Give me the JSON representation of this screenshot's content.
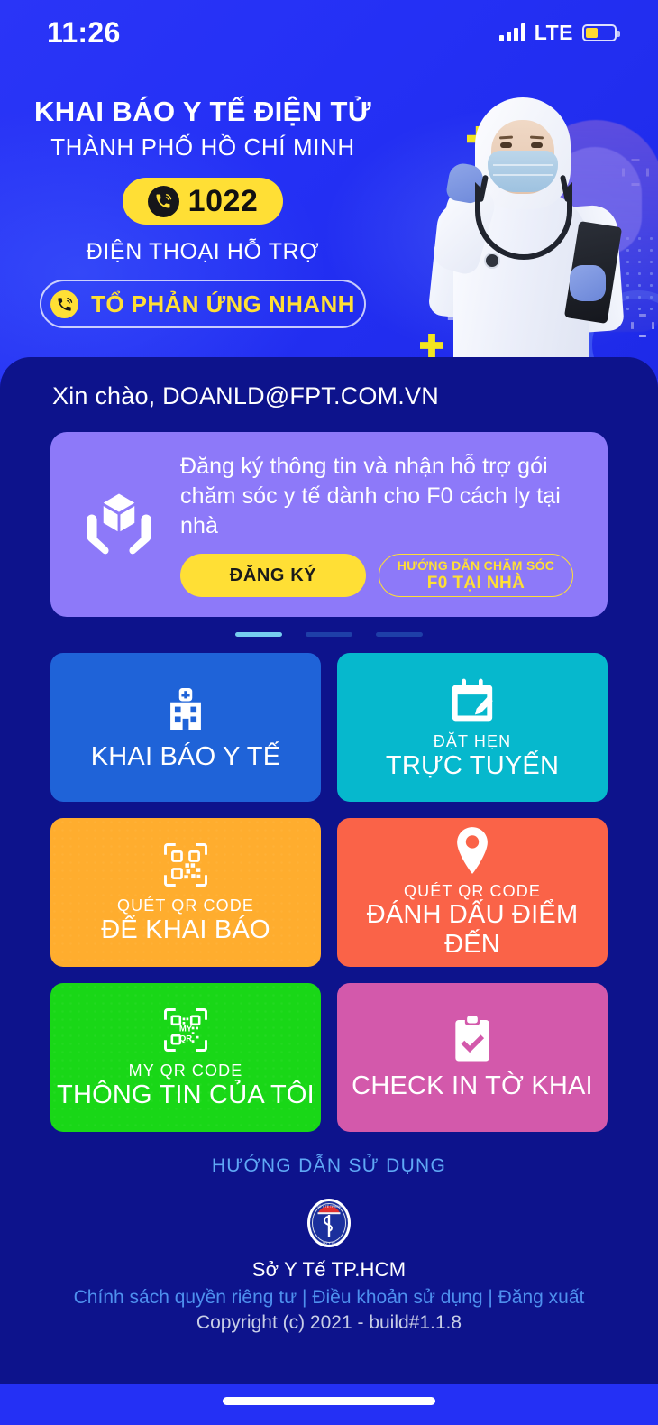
{
  "status_bar": {
    "time": "11:26",
    "network": "LTE",
    "signal_icon": "cellular-signal-icon",
    "battery_icon": "battery-low-power-icon"
  },
  "hero": {
    "title": "KHAI BÁO Y TẾ ĐIỆN TỬ",
    "subtitle": "THÀNH PHỐ HỒ CHÍ MINH",
    "hotline_number": "1022",
    "hotline_label": "ĐIỆN THOẠI HỖ TRỢ",
    "quick_response_button": "TỔ PHẢN ỨNG NHANH",
    "phone_icon": "phone-ring-icon",
    "illustration": "healthcare-worker-ppe-illustration"
  },
  "panel": {
    "greeting": "Xin chào, DOANLD@FPT.COM.VN"
  },
  "banner": {
    "icon": "hands-holding-box-icon",
    "message": "Đăng ký thông tin và nhận hỗ trợ gói chăm sóc y tế dành cho F0 cách ly tại nhà",
    "register_button": "ĐĂNG KÝ",
    "guide_button_line1": "HƯỚNG DẪN CHĂM SÓC",
    "guide_button_line2": "F0 TẠI NHÀ",
    "carousel": {
      "count": 3,
      "active_index": 0
    }
  },
  "tiles": [
    {
      "icon": "hospital-building-icon",
      "small_label": "",
      "big_label": "KHAI BÁO Y TẾ",
      "color": "#1f63d8"
    },
    {
      "icon": "calendar-pen-icon",
      "small_label": "ĐẶT HẸN",
      "big_label": "TRỰC TUYẾN",
      "color": "#06b8cd"
    },
    {
      "icon": "qr-scan-icon",
      "small_label": "QUÉT QR CODE",
      "big_label": "ĐỂ KHAI BÁO",
      "color": "#ffad2e"
    },
    {
      "icon": "map-pin-icon",
      "small_label": "QUÉT QR CODE",
      "big_label": "ĐÁNH DẤU ĐIỂM ĐẾN",
      "color": "#fa6348"
    },
    {
      "icon": "my-qr-code-icon",
      "small_label": "MY QR CODE",
      "big_label": "THÔNG TIN CỦA TÔI",
      "color": "#19d717"
    },
    {
      "icon": "clipboard-check-icon",
      "small_label": "",
      "big_label": "CHECK IN TỜ KHAI",
      "color": "#d359ab"
    }
  ],
  "footer": {
    "guide_link": "HƯỚNG DẪN SỬ DỤNG",
    "logo": "hcmc-health-department-logo",
    "organization": "Sở Y Tế TP.HCM",
    "link_privacy": "Chính sách quyền riêng tư",
    "link_separator_1": " | ",
    "link_terms": "Điều khoản sử dụng",
    "link_separator_2": " | ",
    "link_logout": "Đăng xuất",
    "copyright": "Copyright (c) 2021 - build#1.1.8"
  },
  "colors": {
    "hero_blue": "#2430f5",
    "panel_navy": "#0d138c",
    "accent_yellow": "#ffdf35",
    "banner_purple": "#8d79f9"
  }
}
